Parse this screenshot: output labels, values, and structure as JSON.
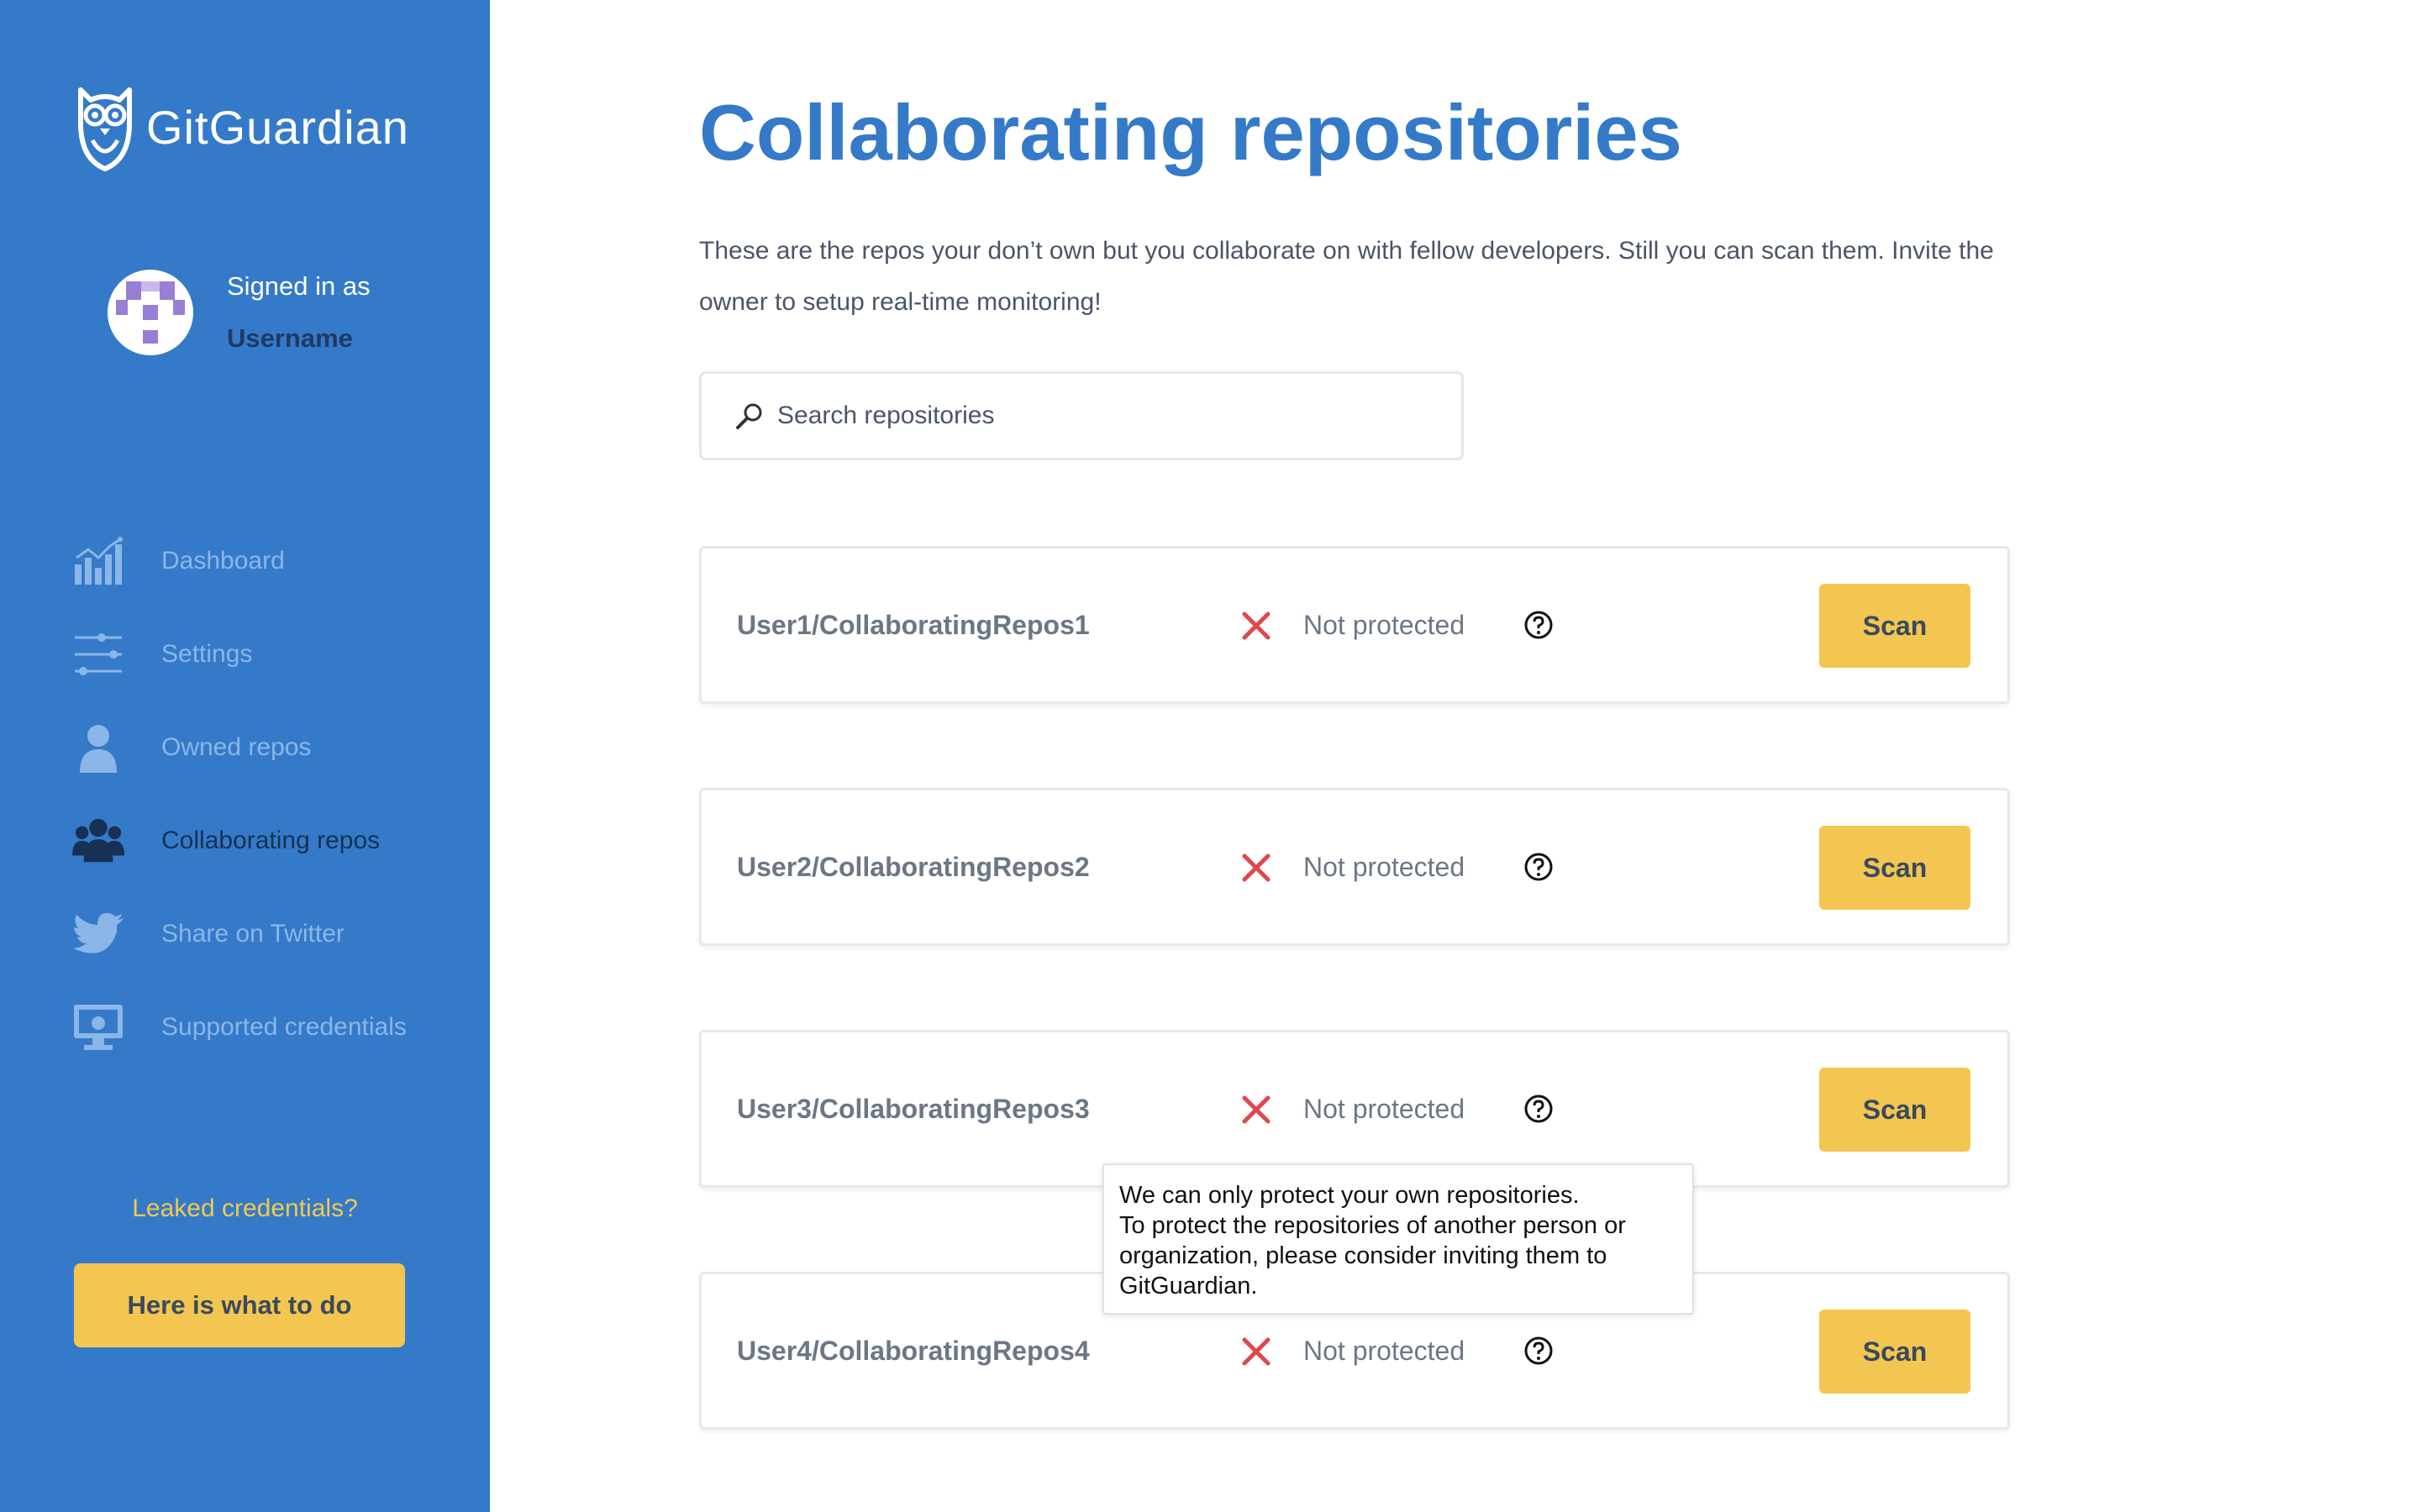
{
  "brand": {
    "name_part1": "Git",
    "name_part2": "Guardian"
  },
  "user": {
    "signed_in_label": "Signed in as",
    "username": "Username"
  },
  "sidebar": {
    "items": [
      {
        "label": "Dashboard",
        "icon": "chart-icon",
        "active": false
      },
      {
        "label": "Settings",
        "icon": "sliders-icon",
        "active": false
      },
      {
        "label": "Owned repos",
        "icon": "user-icon",
        "active": false
      },
      {
        "label": "Collaborating repos",
        "icon": "group-icon",
        "active": true
      },
      {
        "label": "Share on Twitter",
        "icon": "twitter-icon",
        "active": false
      },
      {
        "label": "Supported credentials",
        "icon": "monitor-icon",
        "active": false
      }
    ],
    "leaked_label": "Leaked credentials?",
    "help_button": "Here is what to do"
  },
  "main": {
    "title": "Collaborating repositories",
    "description": "These are the repos your don’t own but you collaborate on with fellow developers. Still you can scan them. Invite the owner to setup real-time monitoring!",
    "search_placeholder": "Search repositories"
  },
  "repos": [
    {
      "name": "User1/CollaboratingRepos1",
      "status": "Not protected",
      "action": "Scan"
    },
    {
      "name": "User2/CollaboratingRepos2",
      "status": "Not protected",
      "action": "Scan"
    },
    {
      "name": "User3/CollaboratingRepos3",
      "status": "Not protected",
      "action": "Scan"
    },
    {
      "name": "User4/CollaboratingRepos4",
      "status": "Not protected",
      "action": "Scan"
    }
  ],
  "tooltip": {
    "line1": "We can only protect your own repositories.",
    "line2": "To protect the repositories of another person or",
    "line3": "organization, please consider inviting them to",
    "line4": "GitGuardian."
  },
  "colors": {
    "sidebar_bg": "#357ac9",
    "accent_yellow": "#f3c652",
    "title_blue": "#357ac9",
    "error_red": "#e0474c"
  }
}
